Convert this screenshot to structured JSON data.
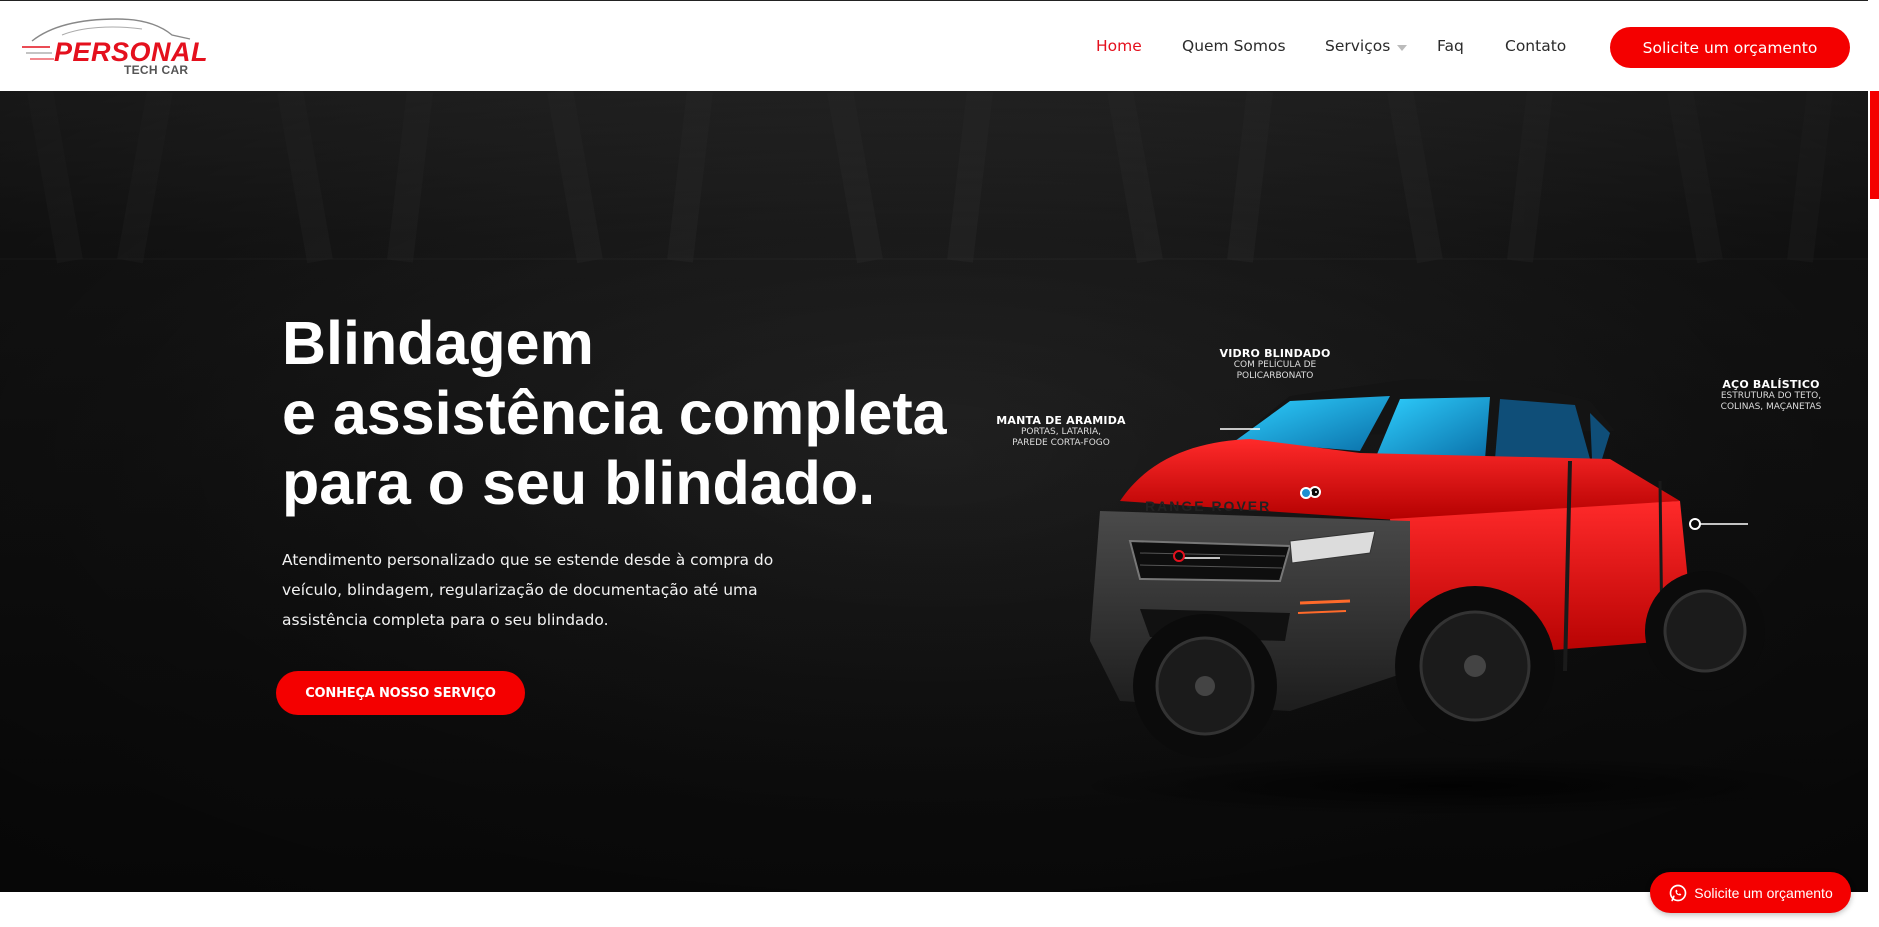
{
  "brand": {
    "name_main": "PERSONAL",
    "name_sub": "TECH CAR",
    "accent_color": "#f40000"
  },
  "nav": {
    "items": [
      {
        "label": "Home",
        "active": true
      },
      {
        "label": "Quem Somos",
        "active": false
      },
      {
        "label": "Serviços",
        "active": false,
        "has_dropdown": true
      },
      {
        "label": "Faq",
        "active": false
      },
      {
        "label": "Contato",
        "active": false
      }
    ],
    "cta_label": "Solicite um orçamento"
  },
  "hero": {
    "title_lines": [
      "Blindagem",
      "e assistência completa",
      "para o seu blindado."
    ],
    "description_lines": [
      "Atendimento personalizado que se estende desde à compra do",
      "veículo, blindagem, regularização de documentação até uma",
      "assistência completa para o seu blindado."
    ],
    "cta_label": "CONHEÇA NOSSO SERVIÇO",
    "callouts": {
      "glass": {
        "title": "VIDRO BLINDADO",
        "sub1": "COM PELÍCULA DE",
        "sub2": "POLICARBONATO"
      },
      "aramid": {
        "title": "MANTA DE ARAMIDA",
        "sub1": "PORTAS, LATARIA,",
        "sub2": "PAREDE CORTA-FOGO"
      },
      "steel": {
        "title": "AÇO BALÍSTICO",
        "sub1": "ESTRUTURA DO TETO,",
        "sub2": "COLINAS, MAÇANETAS"
      },
      "car_badge": "RANGE ROVER"
    }
  },
  "floating": {
    "label": "Solicite um orçamento",
    "icon": "whatsapp-icon"
  }
}
